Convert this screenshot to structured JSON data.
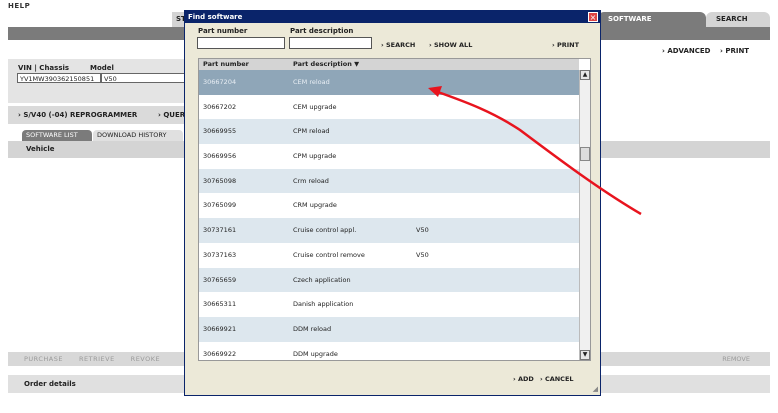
{
  "app": {
    "help": "HELP",
    "tab_st": "ST",
    "tab_software": "SOFTWARE",
    "tab_search": "SEARCH",
    "advanced": "› ADVANCED",
    "print": "› PRINT"
  },
  "vehicle_form": {
    "vin_label": "VIN | Chassis",
    "model_label": "Model",
    "vin_value": "YV1MW390362150851",
    "model_value": "V50"
  },
  "reprog": {
    "label": "› S/V40 (-04) REPROGRAMMER",
    "query": "› QUER"
  },
  "subtabs": {
    "software_list": "SOFTWARE LIST",
    "download_history": "DOWNLOAD HISTORY"
  },
  "vehicle_label": "Vehicle",
  "actions": {
    "purchase": "PURCHASE",
    "retrieve": "RETRIEVE",
    "revoke": "REVOKE",
    "remove": "REMOVE"
  },
  "order_details": "Order details",
  "dialog": {
    "title": "Find software",
    "close": "×",
    "part_number_label": "Part number",
    "part_description_label": "Part description",
    "search": "› SEARCH",
    "show_all": "› SHOW ALL",
    "print": "› PRINT",
    "col_part_number": "Part number",
    "col_part_description": "Part description ▼",
    "add": "› ADD",
    "cancel": "› CANCEL",
    "rows": [
      {
        "pn": "30667204",
        "desc": "CEM reload",
        "model": ""
      },
      {
        "pn": "30667202",
        "desc": "CEM upgrade",
        "model": ""
      },
      {
        "pn": "30669955",
        "desc": "CPM reload",
        "model": ""
      },
      {
        "pn": "30669956",
        "desc": "CPM upgrade",
        "model": ""
      },
      {
        "pn": "30765098",
        "desc": "Crm reload",
        "model": ""
      },
      {
        "pn": "30765099",
        "desc": "CRM upgrade",
        "model": ""
      },
      {
        "pn": "30737161",
        "desc": "Cruise control appl.",
        "model": "V50"
      },
      {
        "pn": "30737163",
        "desc": "Cruise control remove",
        "model": "V50"
      },
      {
        "pn": "30765659",
        "desc": "Czech application",
        "model": ""
      },
      {
        "pn": "30665311",
        "desc": "Danish application",
        "model": ""
      },
      {
        "pn": "30669921",
        "desc": "DDM reload",
        "model": ""
      },
      {
        "pn": "30669922",
        "desc": "DDM upgrade",
        "model": ""
      }
    ]
  },
  "colors": {
    "arrow": "#e8141e",
    "selected_row": "#8fa6b8",
    "alt_row": "#dde7ee",
    "title_bar": "#0a246a"
  }
}
